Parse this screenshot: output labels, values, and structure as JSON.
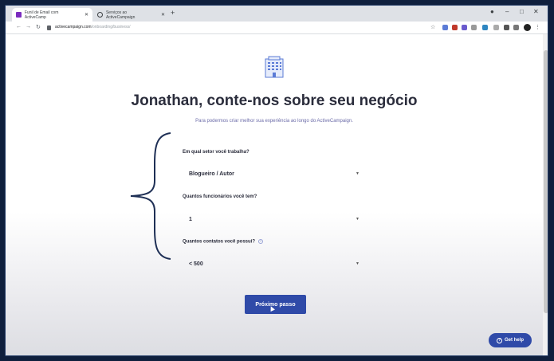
{
  "browser": {
    "tabs": [
      {
        "label": "Funil de Email com ActiveCamp",
        "favicon_color": "#7b2cbf"
      },
      {
        "label": "Serviços ao ActiveCampaign",
        "favicon_color": "#3c4043"
      }
    ],
    "new_tab": "+",
    "url_domain": "activecampaign.com",
    "url_path": "/onboarding/business/",
    "back_icon": "arrow-left",
    "forward_icon": "arrow-right",
    "reload_icon": "reload"
  },
  "page": {
    "title": "Jonathan, conte-nos sobre seu negócio",
    "subtitle": "Para podermos criar melhor sua experiência ao longo do ActiveCampaign.",
    "questions": [
      {
        "label": "Em qual setor você trabalha?",
        "value": "Blogueiro / Autor"
      },
      {
        "label": "Quantos funcionários você tem?",
        "value": "1"
      },
      {
        "label": "Quantos contatos você possui?",
        "value": "< 500"
      }
    ],
    "next_button": "Próximo passo",
    "get_help": "Get help",
    "accent_color": "#2f4aa8"
  }
}
